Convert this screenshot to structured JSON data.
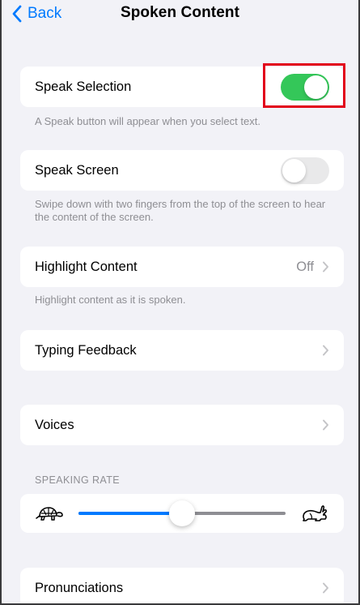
{
  "nav": {
    "back_label": "Back",
    "title": "Spoken Content"
  },
  "speak_selection": {
    "label": "Speak Selection",
    "enabled": true,
    "footer": "A Speak button will appear when you select text."
  },
  "speak_screen": {
    "label": "Speak Screen",
    "enabled": false,
    "footer": "Swipe down with two fingers from the top of the screen to hear the content of the screen."
  },
  "highlight_content": {
    "label": "Highlight Content",
    "value": "Off",
    "footer": "Highlight content as it is spoken."
  },
  "typing_feedback": {
    "label": "Typing Feedback"
  },
  "voices": {
    "label": "Voices"
  },
  "speaking_rate": {
    "header": "SPEAKING RATE",
    "value": 0.5
  },
  "pronunciations": {
    "label": "Pronunciations"
  },
  "colors": {
    "accent": "#007aff",
    "toggle_on": "#34c759",
    "highlight": "#e2001a"
  }
}
